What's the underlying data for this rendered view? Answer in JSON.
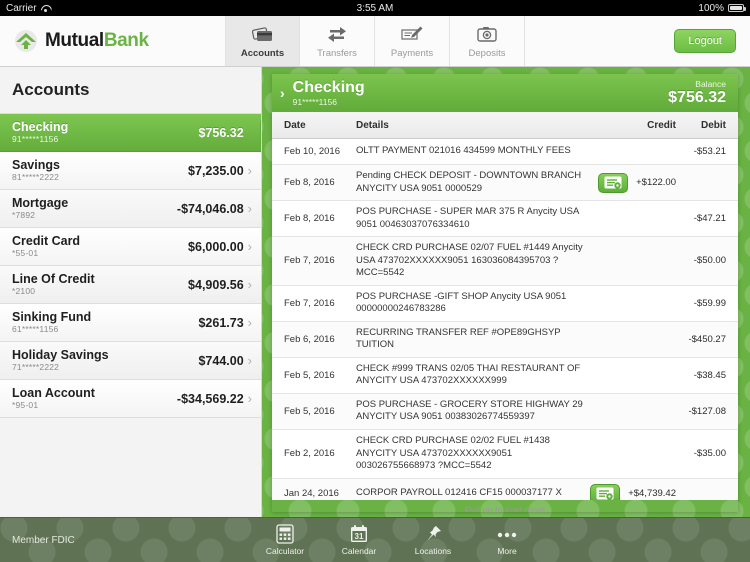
{
  "statusbar": {
    "carrier": "Carrier",
    "time": "3:55 AM",
    "battery": "100%"
  },
  "brand": {
    "name_part1": "Mutual",
    "name_part2": "Bank",
    "mark_icon": "mountain-arrow-logo-icon"
  },
  "topnav": {
    "tabs": [
      {
        "label": "Accounts",
        "icon": "credit-cards-icon",
        "active": true
      },
      {
        "label": "Transfers",
        "icon": "transfer-arrows-icon",
        "active": false
      },
      {
        "label": "Payments",
        "icon": "check-pen-icon",
        "active": false
      },
      {
        "label": "Deposits",
        "icon": "camera-icon",
        "active": false
      }
    ],
    "logout_label": "Logout"
  },
  "sidebar": {
    "title": "Accounts",
    "accounts": [
      {
        "name": "Checking",
        "number": "91*****1156",
        "balance": "$756.32",
        "selected": true
      },
      {
        "name": "Savings",
        "number": "81*****2222",
        "balance": "$7,235.00",
        "selected": false
      },
      {
        "name": "Mortgage",
        "number": "*7892",
        "balance": "-$74,046.08",
        "selected": false
      },
      {
        "name": "Credit Card",
        "number": "*55-01",
        "balance": "$6,000.00",
        "selected": false
      },
      {
        "name": "Line Of Credit",
        "number": "*2100",
        "balance": "$4,909.56",
        "selected": false
      },
      {
        "name": "Sinking Fund",
        "number": "61*****1156",
        "balance": "$261.73",
        "selected": false
      },
      {
        "name": "Holiday Savings",
        "number": "71*****2222",
        "balance": "$744.00",
        "selected": false
      },
      {
        "name": "Loan Account",
        "number": "*95-01",
        "balance": "-$34,569.22",
        "selected": false
      }
    ]
  },
  "panel": {
    "arrow_icon": "chevron-right-icon",
    "account_name": "Checking",
    "account_number": "91*****1156",
    "balance_label": "Balance",
    "balance_value": "$756.32",
    "columns": {
      "date": "Date",
      "details": "Details",
      "credit": "Credit",
      "debit": "Debit"
    },
    "load_more": "Pull up to load more",
    "transactions": [
      {
        "date": "Feb 10, 2016",
        "details": "OLTT PAYMENT 021016 434599 MONTHLY FEES",
        "credit": "",
        "debit": "-$53.21",
        "check_image": false
      },
      {
        "date": "Feb 8, 2016",
        "details": "Pending CHECK DEPOSIT - DOWNTOWN BRANCH ANYCITY USA 9051 0000529",
        "credit": "+$122.00",
        "debit": "",
        "check_image": true
      },
      {
        "date": "Feb 8, 2016",
        "details": "POS PURCHASE -  SUPER MAR 375 R Anycity USA 9051 00463037076334610",
        "credit": "",
        "debit": "-$47.21",
        "check_image": false
      },
      {
        "date": "Feb 7, 2016",
        "details": "CHECK CRD PURCHASE 02/07  FUEL #1449 Anycity USA 473702XXXXXX9051 163036084395703 ?MCC=5542",
        "credit": "",
        "debit": "-$50.00",
        "check_image": false
      },
      {
        "date": "Feb 7, 2016",
        "details": "POS PURCHASE -GIFT SHOP Anycity USA 9051 00000000246783286",
        "credit": "",
        "debit": "-$59.99",
        "check_image": false
      },
      {
        "date": "Feb 6, 2016",
        "details": "RECURRING TRANSFER REF #OPE89GHSYP TUITION",
        "credit": "",
        "debit": "-$450.27",
        "check_image": false
      },
      {
        "date": "Feb 5, 2016",
        "details": "CHECK #999 TRANS 02/05 THAI RESTAURANT OF ANYCITY USA 473702XXXXXX999",
        "credit": "",
        "debit": "-$38.45",
        "check_image": false
      },
      {
        "date": "Feb 5, 2016",
        "details": "POS PURCHASE - GROCERY STORE HIGHWAY 29 ANYCITY USA 9051 00383026774559397",
        "credit": "",
        "debit": "-$127.08",
        "check_image": false
      },
      {
        "date": "Feb 2, 2016",
        "details": "CHECK CRD PURCHASE 02/02 FUEL #1438 ANYCITY USA 473702XXXXXX9051 003026755668973 ?MCC=5542",
        "credit": "",
        "debit": "-$35.00",
        "check_image": false
      },
      {
        "date": "Jan 24, 2016",
        "details": "CORPOR PAYROLL 012416 CF15 000037177 X",
        "credit": "+$4,739.42",
        "debit": "",
        "check_image": true
      }
    ]
  },
  "footer": {
    "fdic": "Member FDIC",
    "tools": [
      {
        "label": "Calculator",
        "icon": "calculator-icon"
      },
      {
        "label": "Calendar",
        "icon": "calendar-icon"
      },
      {
        "label": "Locations",
        "icon": "pin-icon"
      },
      {
        "label": "More",
        "icon": "ellipsis-icon"
      }
    ]
  },
  "colors": {
    "brand_green": "#6ab344",
    "header_green": "#61ab3a",
    "footer_olive": "#5f7354"
  }
}
